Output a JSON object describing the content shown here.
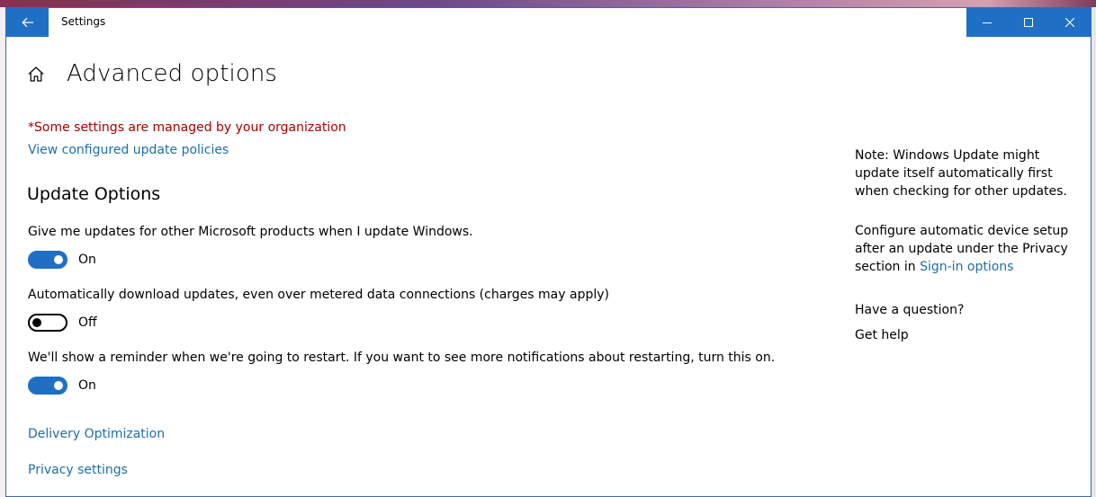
{
  "window": {
    "title": "Settings",
    "accent": "#1f6fc4"
  },
  "header": {
    "title": "Advanced options"
  },
  "notice": {
    "managed_text": "*Some settings are managed by your organization",
    "managed_color": "#a80000",
    "policies_link": "View configured update policies"
  },
  "section": {
    "title": "Update Options"
  },
  "options": [
    {
      "label": "Give me updates for other Microsoft products when I update Windows.",
      "state": "On"
    },
    {
      "label": "Automatically download updates, even over metered data connections (charges may apply)",
      "state": "Off"
    },
    {
      "label": "We'll show a reminder when we're going to restart. If you want to see more notifications about restarting, turn this on.",
      "state": "On"
    }
  ],
  "links": {
    "delivery": "Delivery Optimization",
    "privacy": "Privacy settings"
  },
  "sidebar": {
    "note": "Note: Windows Update might update itself automatically first when checking for other updates.",
    "device_setup_text": "Configure automatic device setup after an update under the Privacy section in",
    "sign_in_link": "Sign-in options",
    "question_heading": "Have a question?",
    "help_link": "Get help"
  },
  "icons": {
    "back": "arrow-left-icon",
    "home": "home-icon",
    "minimize": "minimize-icon",
    "maximize": "maximize-icon",
    "close": "close-icon"
  }
}
